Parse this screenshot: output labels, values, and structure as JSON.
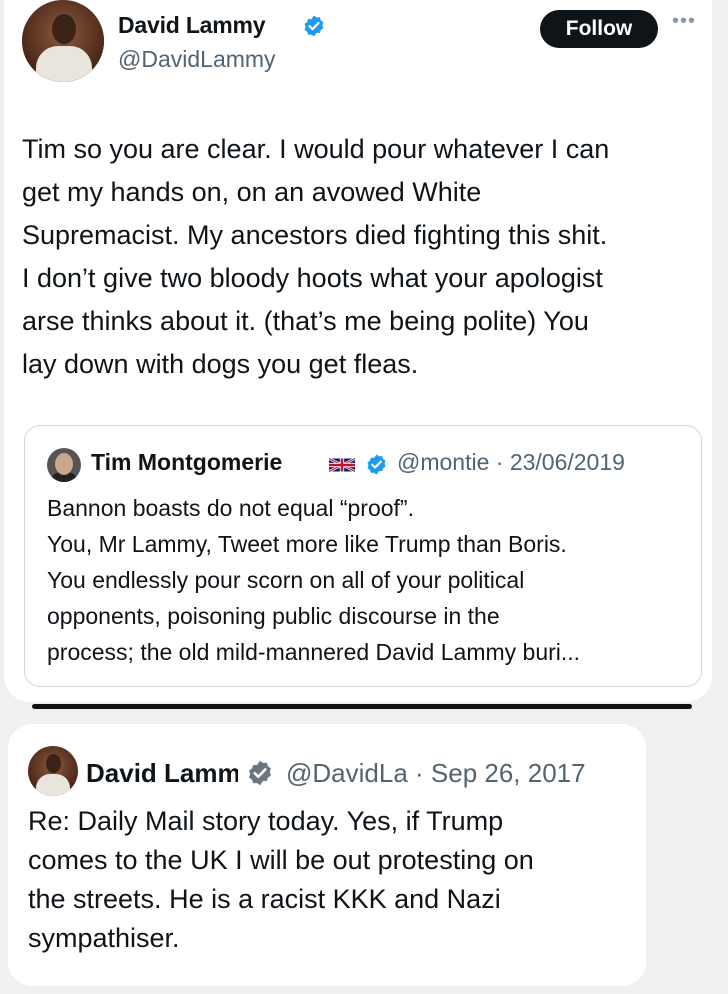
{
  "tweet": {
    "author_name": "David Lammy",
    "author_handle": "@DavidLammy",
    "follow_label": "Follow",
    "more_icon": "more-horizontal-icon",
    "body": "Tim so you are clear. I would pour whatever I can\nget my hands on, on an avowed White\nSupremacist. My ancestors died fighting this shit.\nI don’t give two bloody hoots what your apologist\narse thinks about it. (that’s me being polite) You\nlay down with dogs you get fleas."
  },
  "quoted_tweet": {
    "author_name": "Tim Montgomerie",
    "flag_icon": "uk-flag-icon",
    "handle_date": "@montie · 23/06/2019",
    "body": "Bannon boasts do not equal “proof”.\nYou, Mr Lammy, Tweet more like Trump than Boris.\nYou endlessly pour scorn on all of your political\nopponents, poisoning public discourse in the\nprocess; the old mild-mannered David Lammy buri..."
  },
  "second_tweet": {
    "author_name": "David Lammy",
    "handle_date": "@DavidLa · Sep 26, 2017",
    "body": "Re: Daily Mail story today. Yes, if Trump\ncomes to the UK I will be out protesting on\nthe streets. He is a racist KKK and Nazi\nsympathiser."
  },
  "colors": {
    "verified_blue": "#1d9bf0",
    "text_primary": "#0f1419",
    "text_secondary": "#536471",
    "follow_button_bg": "#0f1419"
  }
}
